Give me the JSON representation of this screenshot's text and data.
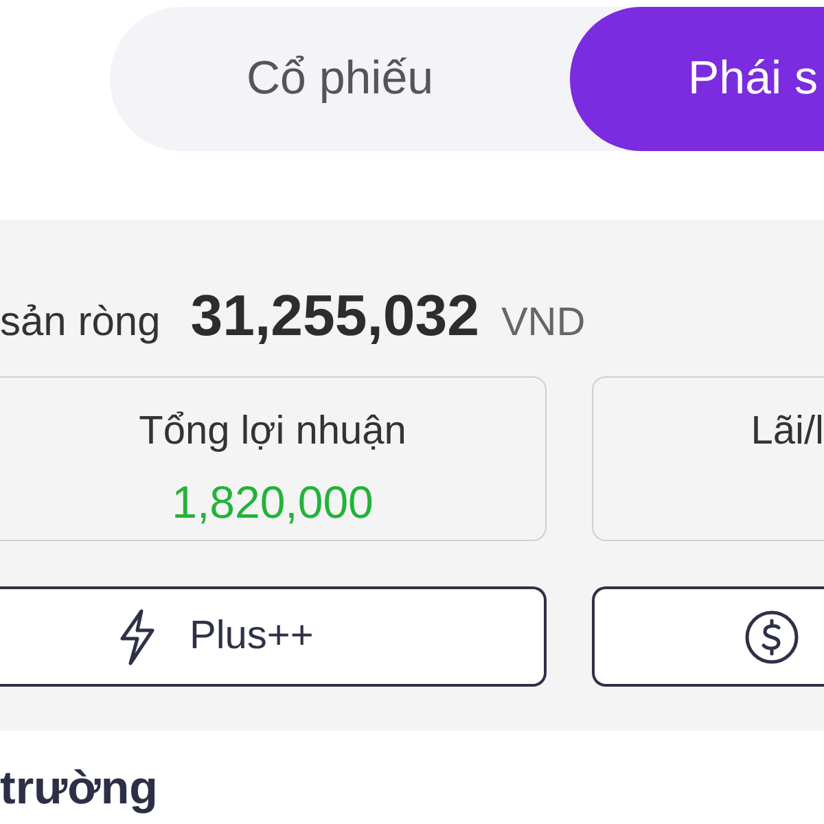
{
  "tabs": [
    {
      "label": "Cổ phiếu",
      "selected": false
    },
    {
      "label": "Phái s",
      "selected": true
    }
  ],
  "net_worth": {
    "label": "sản ròng",
    "value": "31,255,032",
    "unit": "VND"
  },
  "stats": [
    {
      "label": "Tổng lợi nhuận",
      "value": "1,820,000"
    },
    {
      "label": "Lãi/l"
    }
  ],
  "buttons": [
    {
      "kind": "bolt",
      "label": "Plus++"
    },
    {
      "kind": "dollar"
    }
  ],
  "section_title": "trường"
}
